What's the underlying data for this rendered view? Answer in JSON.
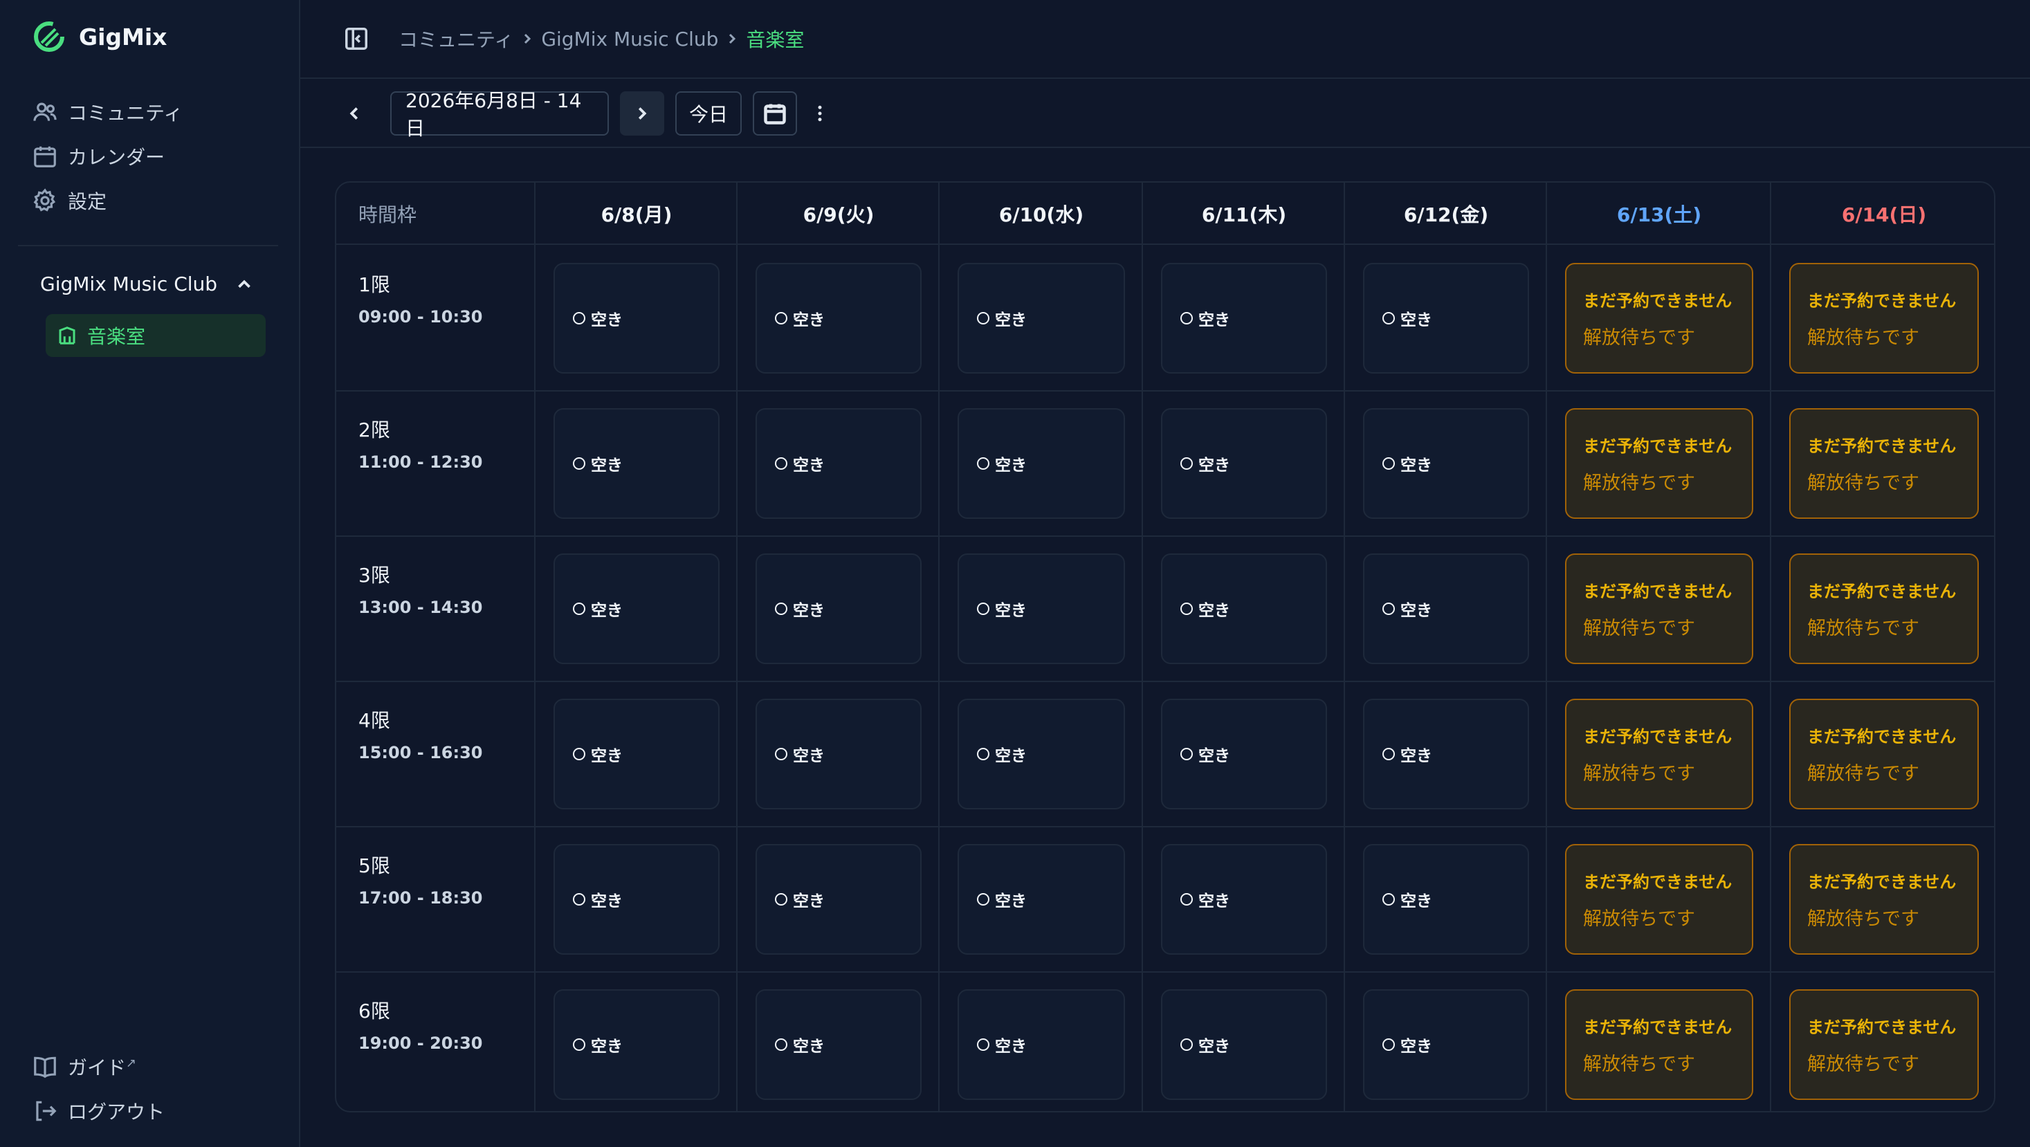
{
  "app": {
    "name": "GigMix"
  },
  "sidebar": {
    "nav": [
      {
        "label": "コミュニティ",
        "icon": "users-icon"
      },
      {
        "label": "カレンダー",
        "icon": "calendar-icon"
      },
      {
        "label": "設定",
        "icon": "gear-icon"
      }
    ],
    "club": {
      "name": "GigMix Music Club",
      "expanded": true
    },
    "room": {
      "label": "音楽室",
      "icon": "building-icon"
    },
    "bottom": [
      {
        "label": "ガイド",
        "icon": "book-icon",
        "external": "↗"
      },
      {
        "label": "ログアウト",
        "icon": "logout-icon"
      }
    ]
  },
  "breadcrumb": {
    "items": [
      "コミュニティ",
      "GigMix Music Club",
      "音楽室"
    ]
  },
  "toolbar": {
    "date_range": "2026年6月8日 - 14日",
    "today_label": "今日"
  },
  "calendar": {
    "header_first": "時間枠",
    "days": [
      {
        "label": "6/8(月)",
        "kind": "weekday"
      },
      {
        "label": "6/9(火)",
        "kind": "weekday"
      },
      {
        "label": "6/10(水)",
        "kind": "weekday"
      },
      {
        "label": "6/11(木)",
        "kind": "weekday"
      },
      {
        "label": "6/12(金)",
        "kind": "weekday"
      },
      {
        "label": "6/13(土)",
        "kind": "sat"
      },
      {
        "label": "6/14(日)",
        "kind": "sun"
      }
    ],
    "periods": [
      {
        "name": "1限",
        "time": "09:00 - 10:30"
      },
      {
        "name": "2限",
        "time": "11:00 - 12:30"
      },
      {
        "name": "3限",
        "time": "13:00 - 14:30"
      },
      {
        "name": "4限",
        "time": "15:00 - 16:30"
      },
      {
        "name": "5限",
        "time": "17:00 - 18:30"
      },
      {
        "name": "6限",
        "time": "19:00 - 20:30"
      }
    ],
    "available_label": "空き",
    "locked_line1": "まだ予約できません",
    "locked_line2": "解放待ちです"
  },
  "colors": {
    "accent": "#4ade80",
    "saturday": "#60a5fa",
    "sunday": "#f87171",
    "locked_border": "#a16207",
    "locked_text": "#eab308"
  }
}
